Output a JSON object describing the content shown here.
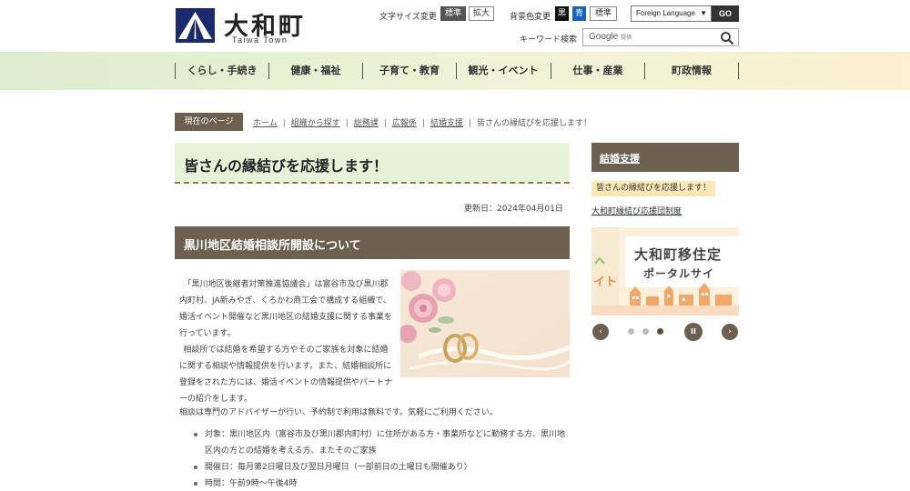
{
  "header": {
    "logo_title": "大和町",
    "logo_sub": "Taiwa Town",
    "font_size_label": "文字サイズ変更",
    "font_size_standard": "標準",
    "font_size_large": "拡大",
    "bg_color_label": "背景色変更",
    "bg_black": "黒",
    "bg_blue": "青",
    "bg_standard": "標準",
    "language_select": "Foreign Language",
    "language_go": "GO",
    "keyword_label": "キーワード検索",
    "search_brand": "Google",
    "search_provided": "提供"
  },
  "nav": {
    "items": [
      {
        "label": "くらし・手続き"
      },
      {
        "label": "健康・福祉"
      },
      {
        "label": "子育て・教育"
      },
      {
        "label": "観光・イベント"
      },
      {
        "label": "仕事・産業"
      },
      {
        "label": "町政情報"
      }
    ]
  },
  "breadcrumb": {
    "tag": "現在のページ",
    "items": [
      {
        "label": "ホーム"
      },
      {
        "label": "組織から探す"
      },
      {
        "label": "総務課"
      },
      {
        "label": "広報係"
      },
      {
        "label": "結婚支援"
      }
    ],
    "current": "皆さんの縁結びを応援します！"
  },
  "main": {
    "title": "皆さんの縁結びを応援します！",
    "updated": "更新日：2024年04月01日",
    "section_heading": "黒川地区結婚相談所開設について",
    "paragraph1": "「黒川地区後継者対策推進協議会」は富谷市及び黒川郡内町村、JA新みやぎ、くろかわ商工会で構成する組織で、婚活イベント開催など黒川地区の結婚支援に関する事業を行っています。",
    "paragraph2": "相談所では結婚を希望する方やそのご家族を対象に結婚に関する相談や情報提供を行います。また、結婚相談所に登録をされた方には、婚活イベントの情報提供やパートナーの紹介をします。",
    "paragraph3": "相談は専門のアドバイザーが行い、予約制で利用は無料です。気軽にご利用ください。",
    "bullets": [
      {
        "text": "対象：黒川地区内（富谷市及び黒川郡内町村）に住所がある方・事業所などに勤務する方、黒川地区内の方との結婚を考える方、またそのご家族"
      },
      {
        "text": "開催日：毎月第2日曜日及び翌日月曜日（一部前日の土曜日も開催あり）"
      },
      {
        "text": "時間：午前9時～午後4時"
      }
    ]
  },
  "sidebar": {
    "heading": "結婚支援",
    "current_item": "皆さんの縁結びを応援します！",
    "link": "大和町縁結び応援団制度",
    "banner_line1": "大和町移住定",
    "banner_line2": "ポータルサイ",
    "banner_left": "イト",
    "slider_prev": "‹",
    "slider_next": "›",
    "slider_pause": "II",
    "slider_dots": 3,
    "slider_active_dot": 3
  },
  "colors": {
    "brand_brown": "#6d6050",
    "title_bg": "#e6f3d8",
    "current_item_bg": "#fbe8b5",
    "logo_navy": "#1a2a6c"
  }
}
